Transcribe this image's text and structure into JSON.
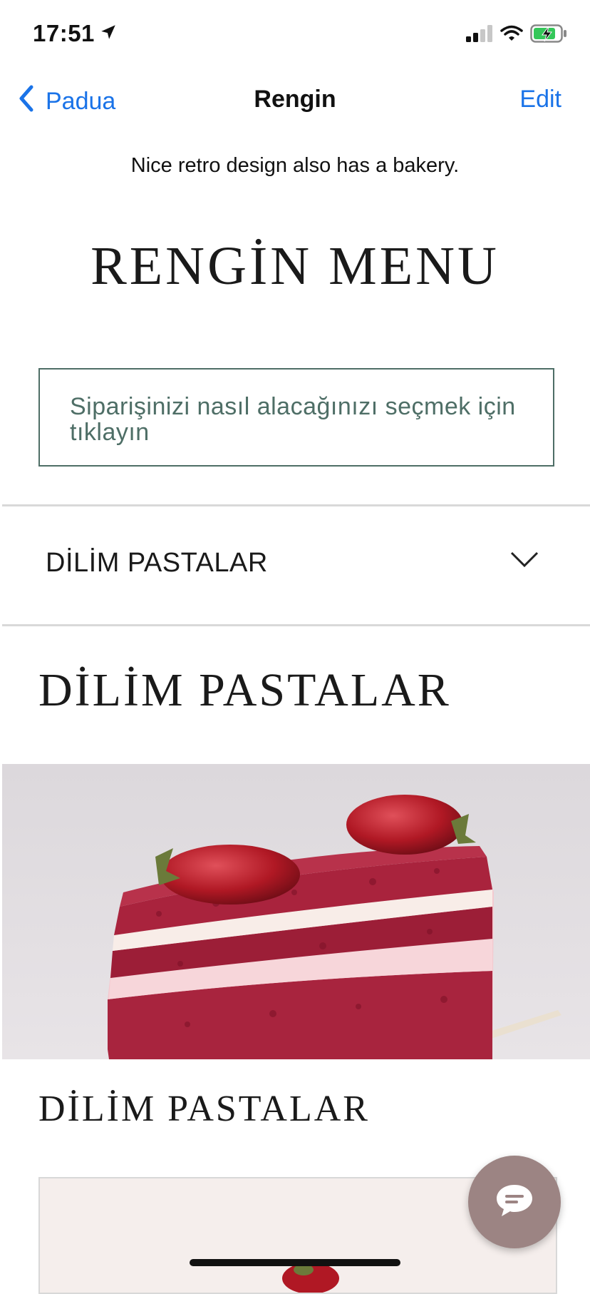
{
  "status_bar": {
    "time": "17:51",
    "battery_charging": true
  },
  "nav": {
    "back_label": "Padua",
    "title": "Rengin",
    "edit_label": "Edit"
  },
  "subtitle": "Nice retro design also has a bakery.",
  "menu": {
    "title": "RENGİN MENU",
    "order_prompt": "Siparişinizi nasıl alacağınızı seçmek için tıklayın",
    "category_dropdown": "DİLİM PASTALAR",
    "section_heading": "DİLİM PASTALAR",
    "item_heading": "DİLİM PASTALAR"
  },
  "colors": {
    "accent": "#1a73e8",
    "order_border": "#4e6e66",
    "chat_button": "#9c8483"
  },
  "icons": [
    "location-arrow-icon",
    "cellular-signal-icon",
    "wifi-icon",
    "battery-charging-icon",
    "chevron-left-icon",
    "chevron-down-icon",
    "chat-bubble-icon"
  ]
}
